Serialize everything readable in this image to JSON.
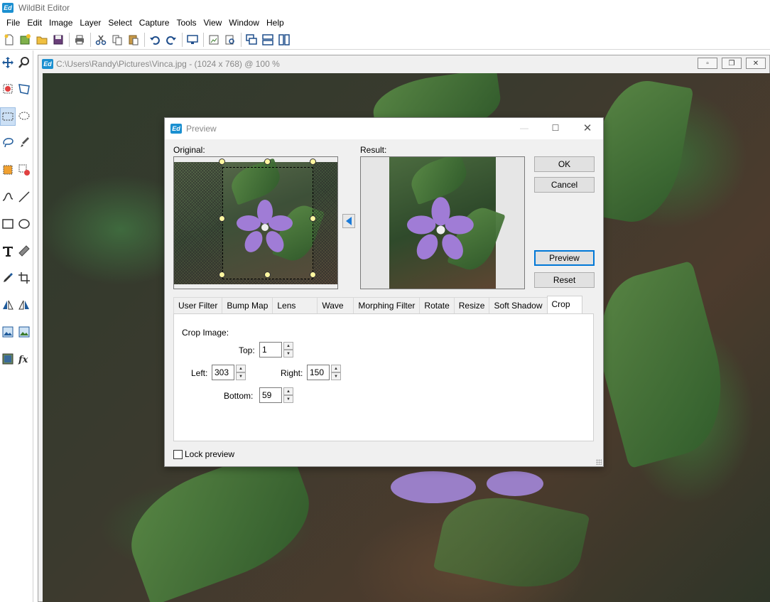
{
  "app": {
    "title": "WildBit Editor",
    "icon_text": "Ed"
  },
  "menu": [
    "File",
    "Edit",
    "Image",
    "Layer",
    "Select",
    "Capture",
    "Tools",
    "View",
    "Window",
    "Help"
  ],
  "document": {
    "title": "C:\\Users\\Randy\\Pictures\\Vinca.jpg - (1024 x 768) @ 100 %",
    "icon_text": "Ed"
  },
  "dialog": {
    "title": "Preview",
    "icon_text": "Ed",
    "original_label": "Original:",
    "result_label": "Result:",
    "buttons": {
      "ok": "OK",
      "cancel": "Cancel",
      "preview": "Preview",
      "reset": "Reset"
    },
    "tabs": [
      "User Filter",
      "Bump Map",
      "Lens",
      "Wave",
      "Morphing Filter",
      "Rotate",
      "Resize",
      "Soft Shadow",
      "Crop"
    ],
    "active_tab": "Crop",
    "crop": {
      "heading": "Crop Image:",
      "top_label": "Top:",
      "top_value": "1",
      "left_label": "Left:",
      "left_value": "303",
      "right_label": "Right:",
      "right_value": "150",
      "bottom_label": "Bottom:",
      "bottom_value": "59"
    },
    "lock_preview_label": "Lock preview"
  }
}
